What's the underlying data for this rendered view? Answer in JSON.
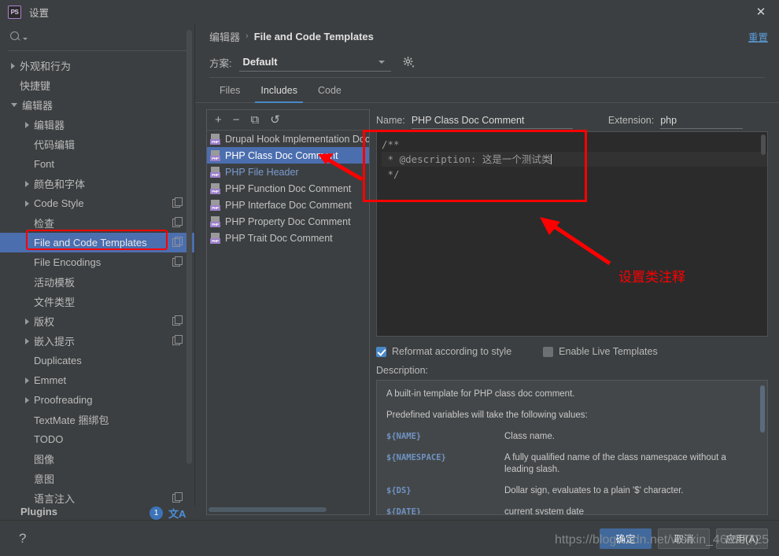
{
  "window": {
    "title": "设置",
    "app_icon": "PS",
    "close_icon": "✕"
  },
  "sidebar": {
    "search_placeholder": "",
    "items": [
      {
        "label": "外观和行为",
        "arrow": "right",
        "indent": 0,
        "copy": false,
        "selected": false
      },
      {
        "label": "快捷键",
        "arrow": "none",
        "indent": 0,
        "copy": false,
        "selected": false
      },
      {
        "label": "编辑器",
        "arrow": "down",
        "indent": 0,
        "copy": false,
        "selected": false
      },
      {
        "label": "编辑器",
        "arrow": "right",
        "indent": 1,
        "copy": false,
        "selected": false
      },
      {
        "label": "代码编辑",
        "arrow": "none",
        "indent": 1,
        "copy": false,
        "selected": false
      },
      {
        "label": "Font",
        "arrow": "none",
        "indent": 1,
        "copy": false,
        "selected": false
      },
      {
        "label": "颜色和字体",
        "arrow": "right",
        "indent": 1,
        "copy": false,
        "selected": false
      },
      {
        "label": "Code Style",
        "arrow": "right",
        "indent": 1,
        "copy": true,
        "selected": false
      },
      {
        "label": "检查",
        "arrow": "none",
        "indent": 1,
        "copy": true,
        "selected": false
      },
      {
        "label": "File and Code Templates",
        "arrow": "none",
        "indent": 1,
        "copy": true,
        "selected": true
      },
      {
        "label": "File Encodings",
        "arrow": "none",
        "indent": 1,
        "copy": true,
        "selected": false
      },
      {
        "label": "活动模板",
        "arrow": "none",
        "indent": 1,
        "copy": false,
        "selected": false
      },
      {
        "label": "文件类型",
        "arrow": "none",
        "indent": 1,
        "copy": false,
        "selected": false
      },
      {
        "label": "版权",
        "arrow": "right",
        "indent": 1,
        "copy": true,
        "selected": false
      },
      {
        "label": "嵌入提示",
        "arrow": "right",
        "indent": 1,
        "copy": true,
        "selected": false
      },
      {
        "label": "Duplicates",
        "arrow": "none",
        "indent": 1,
        "copy": false,
        "selected": false
      },
      {
        "label": "Emmet",
        "arrow": "right",
        "indent": 1,
        "copy": false,
        "selected": false
      },
      {
        "label": "Proofreading",
        "arrow": "right",
        "indent": 1,
        "copy": false,
        "selected": false
      },
      {
        "label": "TextMate 捆绑包",
        "arrow": "none",
        "indent": 1,
        "copy": false,
        "selected": false
      },
      {
        "label": "TODO",
        "arrow": "none",
        "indent": 1,
        "copy": false,
        "selected": false
      },
      {
        "label": "图像",
        "arrow": "none",
        "indent": 1,
        "copy": false,
        "selected": false
      },
      {
        "label": "意图",
        "arrow": "none",
        "indent": 1,
        "copy": false,
        "selected": false
      },
      {
        "label": "语言注入",
        "arrow": "none",
        "indent": 1,
        "copy": true,
        "selected": false
      }
    ],
    "plugins": {
      "label": "Plugins",
      "badge": "1",
      "translate_icon": "文A"
    }
  },
  "main": {
    "breadcrumb": {
      "parent": "编辑器",
      "separator": "›",
      "current": "File and Code Templates"
    },
    "reset_label": "重置",
    "scheme": {
      "label": "方案:",
      "value": "Default",
      "gear_icon": "gear-icon"
    },
    "tabs": [
      {
        "label": "Files",
        "active": false
      },
      {
        "label": "Includes",
        "active": true
      },
      {
        "label": "Code",
        "active": false
      }
    ],
    "list_toolbar": {
      "add": "+",
      "remove": "−",
      "copy": "⧉",
      "revert": "↺"
    },
    "templates": [
      {
        "label": "Drupal Hook Implementation Doc",
        "state": "normal"
      },
      {
        "label": "PHP Class Doc Comment",
        "state": "selected"
      },
      {
        "label": "PHP File Header",
        "state": "muted"
      },
      {
        "label": "PHP Function Doc Comment",
        "state": "normal"
      },
      {
        "label": "PHP Interface Doc Comment",
        "state": "normal"
      },
      {
        "label": "PHP Property Doc Comment",
        "state": "normal"
      },
      {
        "label": "PHP Trait Doc Comment",
        "state": "normal"
      }
    ],
    "editor": {
      "name_label": "Name:",
      "name_value": "PHP Class Doc Comment",
      "extension_label": "Extension:",
      "extension_value": "php",
      "code_lines": [
        "/**",
        " * @description: 这是一个测试类",
        " */"
      ]
    },
    "checkboxes": [
      {
        "label": "Reformat according to style",
        "checked": true
      },
      {
        "label": "Enable Live Templates",
        "checked": false
      }
    ],
    "description": {
      "label": "Description:",
      "paragraphs": [
        "A built-in template for PHP class doc comment.",
        "Predefined variables will take the following values:"
      ],
      "variables": [
        {
          "key": "${NAME}",
          "value": "Class name."
        },
        {
          "key": "${NAMESPACE}",
          "value": "A fully qualified name of the class namespace without a leading slash."
        },
        {
          "key": "${DS}",
          "value": "Dollar sign, evaluates to a plain '$' character."
        },
        {
          "key": "${DATE}",
          "value": "current system date"
        }
      ]
    }
  },
  "footer": {
    "help_icon": "?",
    "buttons": [
      {
        "label": "确定",
        "primary": true
      },
      {
        "label": "取消",
        "primary": false
      },
      {
        "label": "应用(A)",
        "primary": false
      }
    ]
  },
  "annotations": {
    "callout_text": "设置类注释",
    "accent_red": "#ff0000"
  },
  "watermark": "https://blog.csdn.net/weixin_46397725"
}
